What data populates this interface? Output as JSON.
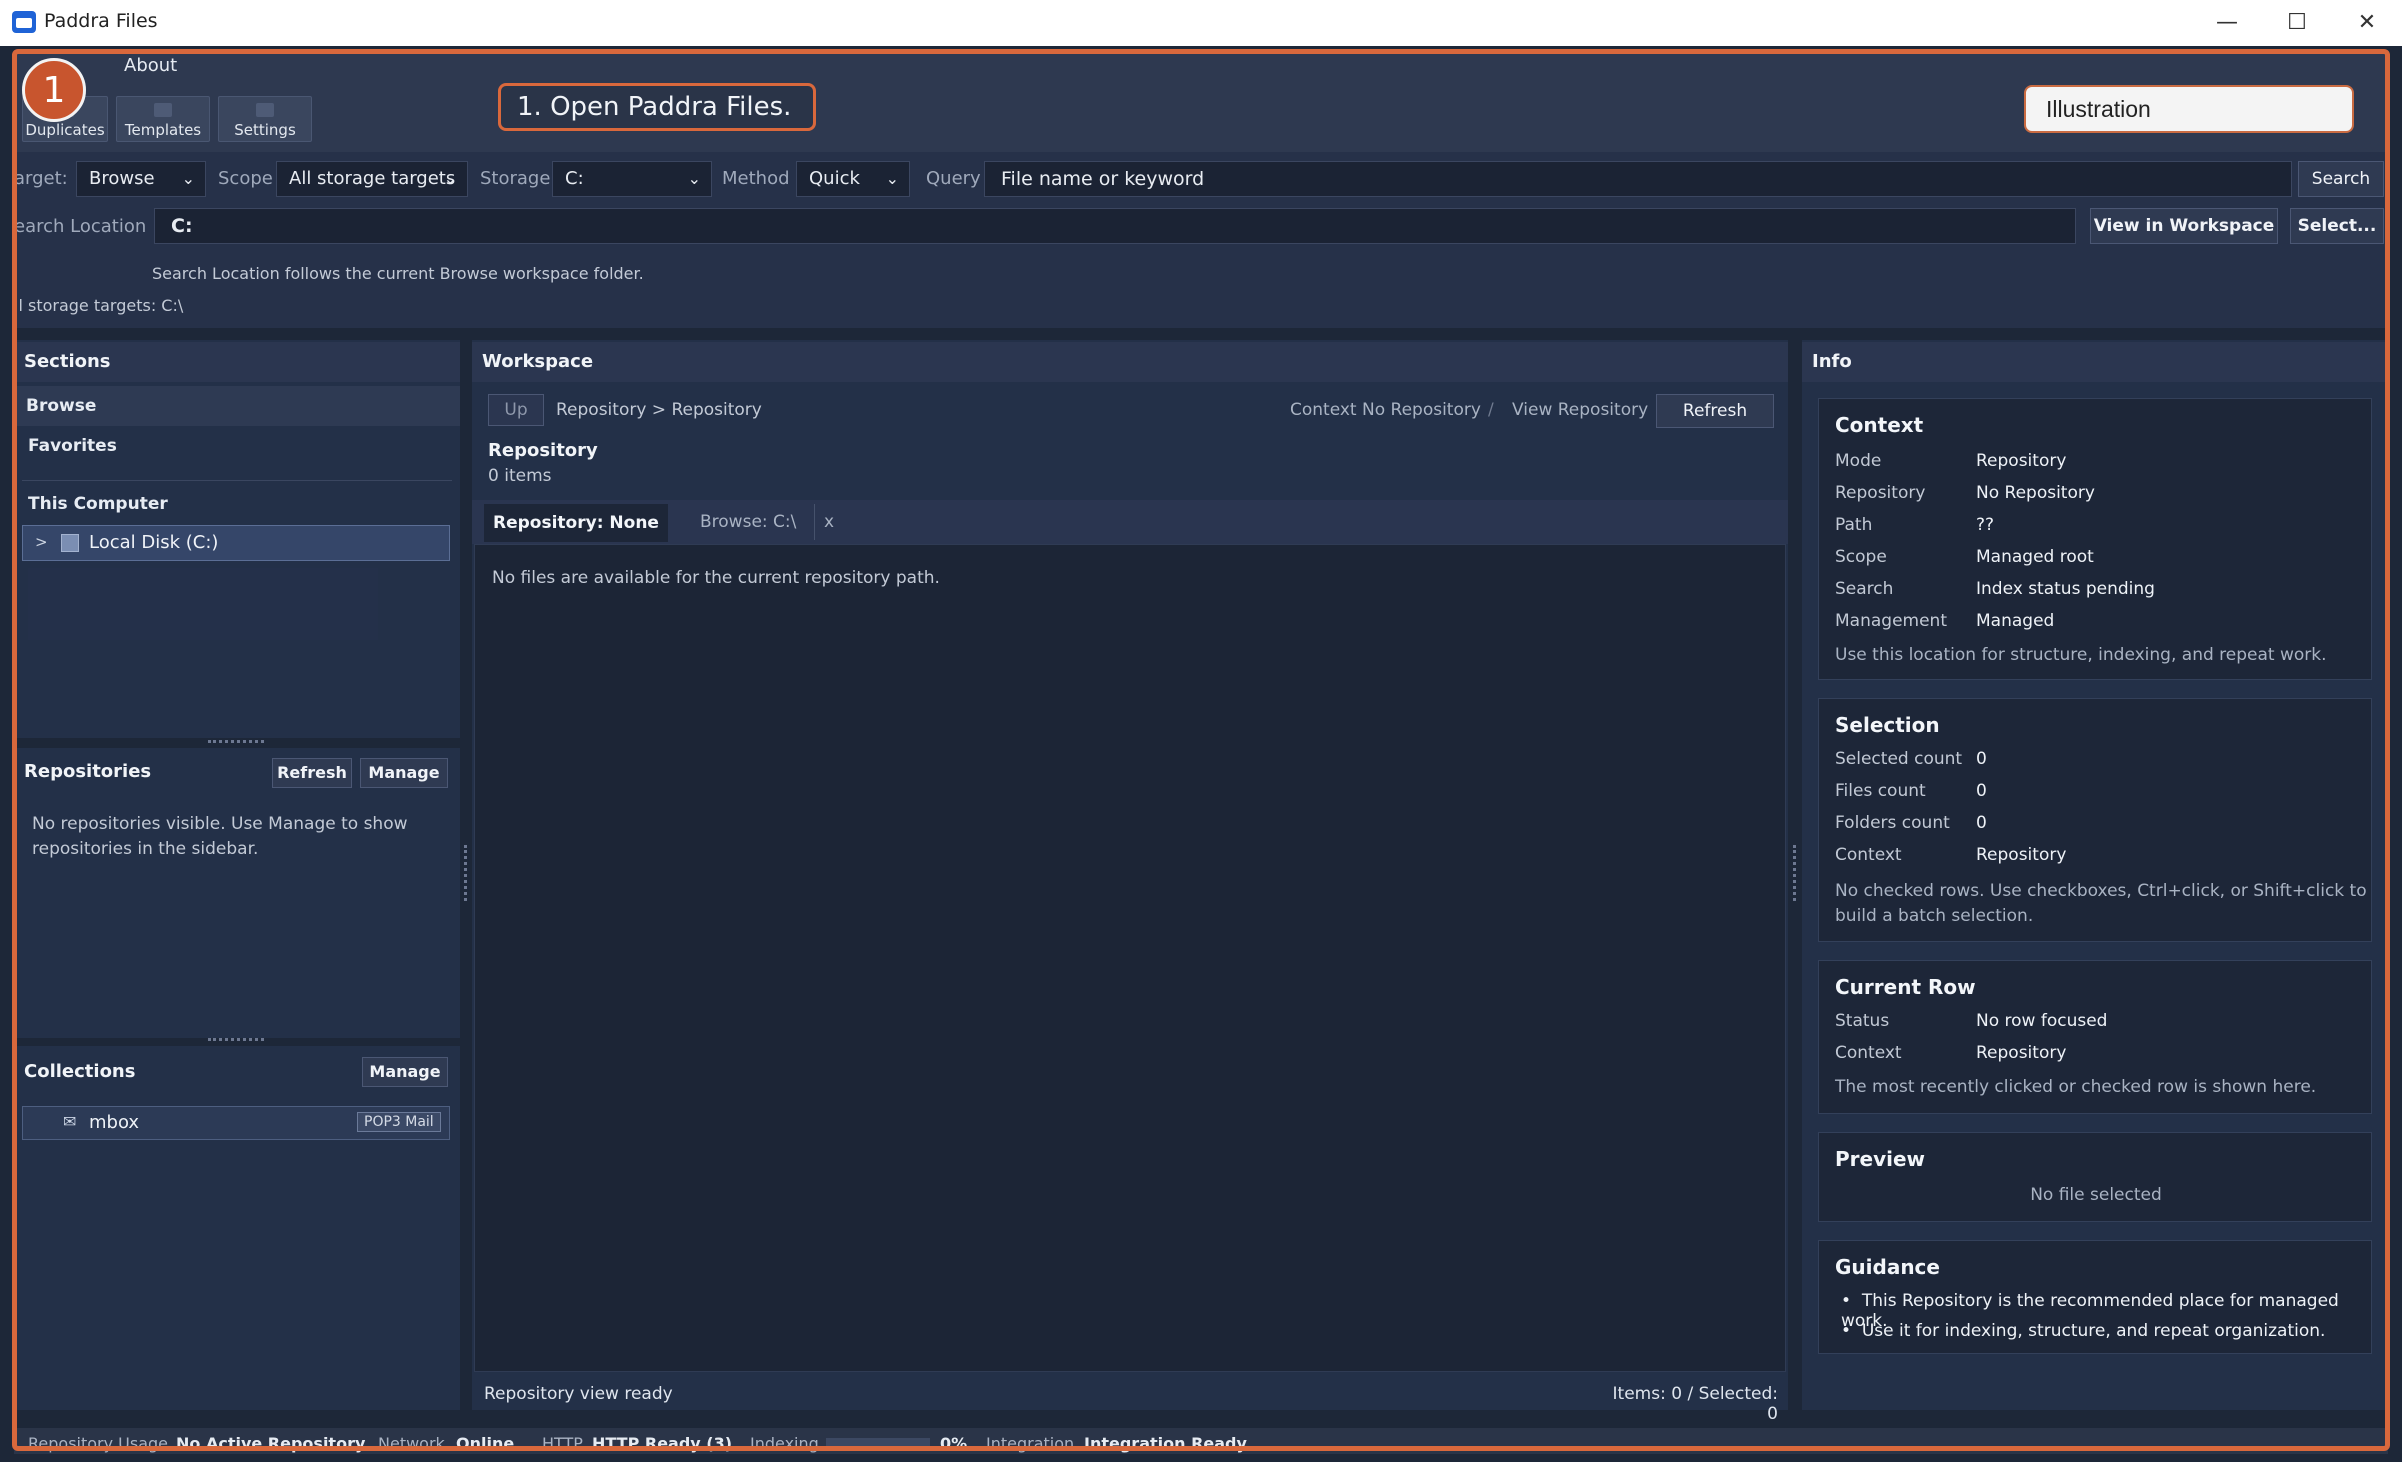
{
  "window": {
    "title": "Paddra Files",
    "minimize": "—",
    "maximize": "☐",
    "close": "✕"
  },
  "menu": {
    "about": "About"
  },
  "toolbar": {
    "duplicates": "Duplicates",
    "templates": "Templates",
    "settings": "Settings"
  },
  "overlay": {
    "step_number": "1",
    "callout": "1. Open Paddra Files.",
    "illustration": "Illustration"
  },
  "search": {
    "target_label": "arget:",
    "target_value": "Browse",
    "scope_label": "Scope",
    "scope_value": "All storage targets",
    "storage_label": "Storage",
    "storage_value": "C:",
    "method_label": "Method",
    "method_value": "Quick",
    "query_label": "Query",
    "query_placeholder": "File name or keyword",
    "search_button": "Search",
    "location_label": "earch Location",
    "location_value": "C:",
    "view_workspace_button": "View in Workspace",
    "select_button": "Select...",
    "location_note": "Search Location follows the current Browse workspace folder.",
    "storage_targets_note": "ll storage targets: C:\\"
  },
  "sections": {
    "header": "Sections",
    "browse": "Browse",
    "favorites": "Favorites",
    "this_computer": "This Computer",
    "drive": {
      "expander": ">",
      "label": "Local Disk (C:)"
    }
  },
  "repositories": {
    "header": "Repositories",
    "refresh": "Refresh",
    "manage": "Manage",
    "empty": "No repositories visible. Use Manage to show repositories in the sidebar."
  },
  "collections": {
    "header": "Collections",
    "manage": "Manage",
    "item": {
      "label": "mbox",
      "badge": "POP3 Mail"
    }
  },
  "workspace": {
    "header": "Workspace",
    "up": "Up",
    "breadcrumb": "Repository > Repository",
    "context": "Context No Repository",
    "sep": "/",
    "view": "View Repository",
    "refresh": "Refresh",
    "title": "Repository",
    "count": "0 items",
    "tabs": [
      {
        "label": "Repository: None"
      },
      {
        "label": "Browse: C:\\"
      },
      {
        "label": "x"
      }
    ],
    "empty": "No files are available for the current repository path.",
    "status_left": "Repository view ready",
    "status_right": "Items: 0 / Selected: 0"
  },
  "info": {
    "header": "Info",
    "context": {
      "title": "Context",
      "rows": [
        {
          "k": "Mode",
          "v": "Repository"
        },
        {
          "k": "Repository",
          "v": "No Repository"
        },
        {
          "k": "Path",
          "v": "??"
        },
        {
          "k": "Scope",
          "v": "Managed root"
        },
        {
          "k": "Search",
          "v": "Index status pending"
        },
        {
          "k": "Management",
          "v": "Managed"
        }
      ],
      "note": "Use this location for structure, indexing, and repeat work."
    },
    "selection": {
      "title": "Selection",
      "rows": [
        {
          "k": "Selected count",
          "v": "0"
        },
        {
          "k": "Files count",
          "v": "0"
        },
        {
          "k": "Folders count",
          "v": "0"
        },
        {
          "k": "Context",
          "v": "Repository"
        }
      ],
      "note1": "No checked rows. Use checkboxes, Ctrl+click, or Shift+click to",
      "note2": "build a batch selection."
    },
    "current_row": {
      "title": "Current Row",
      "rows": [
        {
          "k": "Status",
          "v": "No row focused"
        },
        {
          "k": "Context",
          "v": "Repository"
        }
      ],
      "note": "The most recently clicked or checked row is shown here."
    },
    "preview": {
      "title": "Preview",
      "empty": "No file selected"
    },
    "guidance": {
      "title": "Guidance",
      "items": [
        "This Repository is the recommended place for managed work.",
        "Use it for indexing, structure, and repeat organization."
      ]
    }
  },
  "statusbar": {
    "repo_usage_label": "Repository Usage",
    "repo_usage_value": "No Active Repository",
    "network_label": "Network",
    "network_value": "Online",
    "http_label": "HTTP",
    "http_value": "HTTP Ready (3)",
    "indexing_label": "Indexing",
    "indexing_value": "0%",
    "integration_label": "Integration",
    "integration_value": "Integration Ready"
  },
  "colors": {
    "accent": "#d9683c",
    "background": "#1d2738",
    "panel": "#233048"
  }
}
